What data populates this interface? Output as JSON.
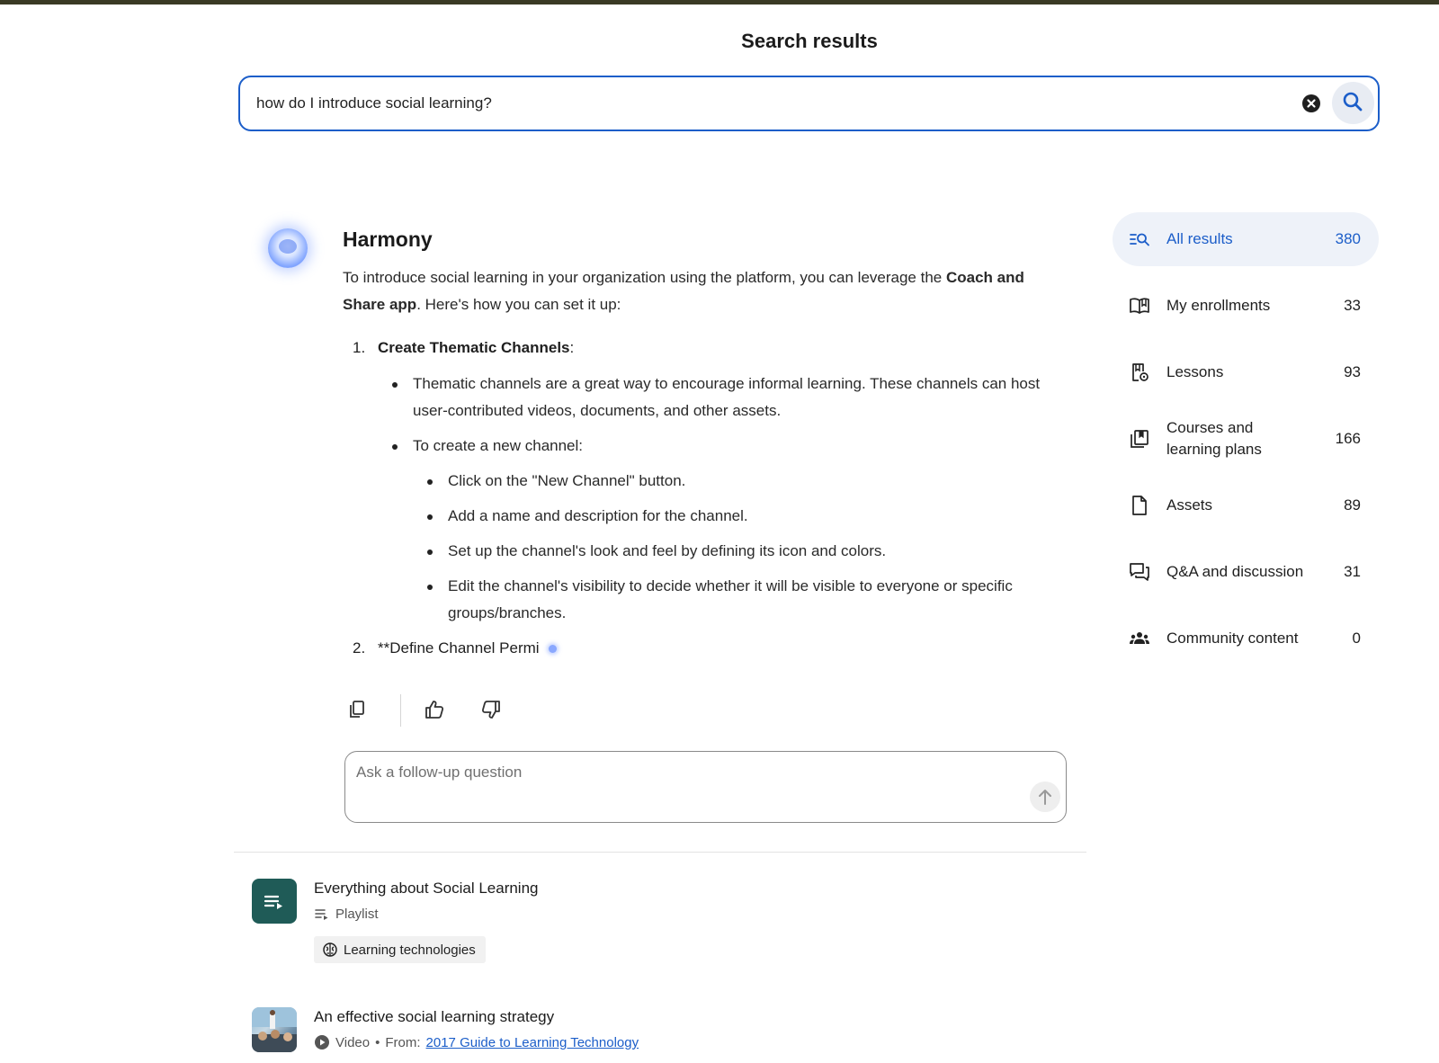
{
  "header": {
    "title": "Search results"
  },
  "search": {
    "value": "how do I introduce social learning?"
  },
  "answer": {
    "assistant_name": "Harmony",
    "intro_before": "To introduce social learning in your organization using the platform, you can leverage the ",
    "intro_bold": "Coach and Share app",
    "intro_after": ". Here's how you can set it up:",
    "steps": [
      {
        "number": "1.",
        "title": "Create Thematic Channels",
        "suffix": ":",
        "bullets": [
          "Thematic channels are a great way to encourage informal learning. These channels can host user-contributed videos, documents, and other assets.",
          "To create a new channel:"
        ],
        "sub_bullets": [
          "Click on the \"New Channel\" button.",
          "Add a name and description for the channel.",
          "Set up the channel's look and feel by defining its icon and colors.",
          "Edit the channel's visibility to decide whether it will be visible to everyone or specific groups/branches."
        ]
      },
      {
        "number": "2.",
        "text": "**Define Channel Permi"
      }
    ]
  },
  "actions": {
    "copy_icon": "copy-icon",
    "like_icon": "thumbs-up-icon",
    "dislike_icon": "thumbs-down-icon"
  },
  "followup": {
    "placeholder": "Ask a follow-up question"
  },
  "results": [
    {
      "title": "Everything about Social Learning",
      "type_label": "Playlist",
      "type_icon": "playlist-icon",
      "tag": "Learning technologies",
      "tag_icon": "brain-icon"
    },
    {
      "title": "An effective social learning strategy",
      "type_label": "Video",
      "type_icon": "play-circle-icon",
      "separator": "•",
      "from_label": "From:",
      "from_link": "2017 Guide to Learning Technology"
    }
  ],
  "filters": [
    {
      "label": "All results",
      "count": "380",
      "icon": "list-search-icon",
      "active": true
    },
    {
      "label": "My enrollments",
      "count": "33",
      "icon": "book-open-icon"
    },
    {
      "label": "Lessons",
      "count": "93",
      "icon": "lesson-icon"
    },
    {
      "label": "Courses and learning plans",
      "count": "166",
      "icon": "courses-icon"
    },
    {
      "label": "Assets",
      "count": "89",
      "icon": "document-icon"
    },
    {
      "label": "Q&A and discussion",
      "count": "31",
      "icon": "chat-icon"
    },
    {
      "label": "Community content",
      "count": "0",
      "icon": "community-icon"
    }
  ],
  "colors": {
    "accent": "#1c5ec9",
    "active_bg": "#eef2f9",
    "playlist_thumb": "#1f5b57",
    "top_bar": "#3a3a24"
  }
}
